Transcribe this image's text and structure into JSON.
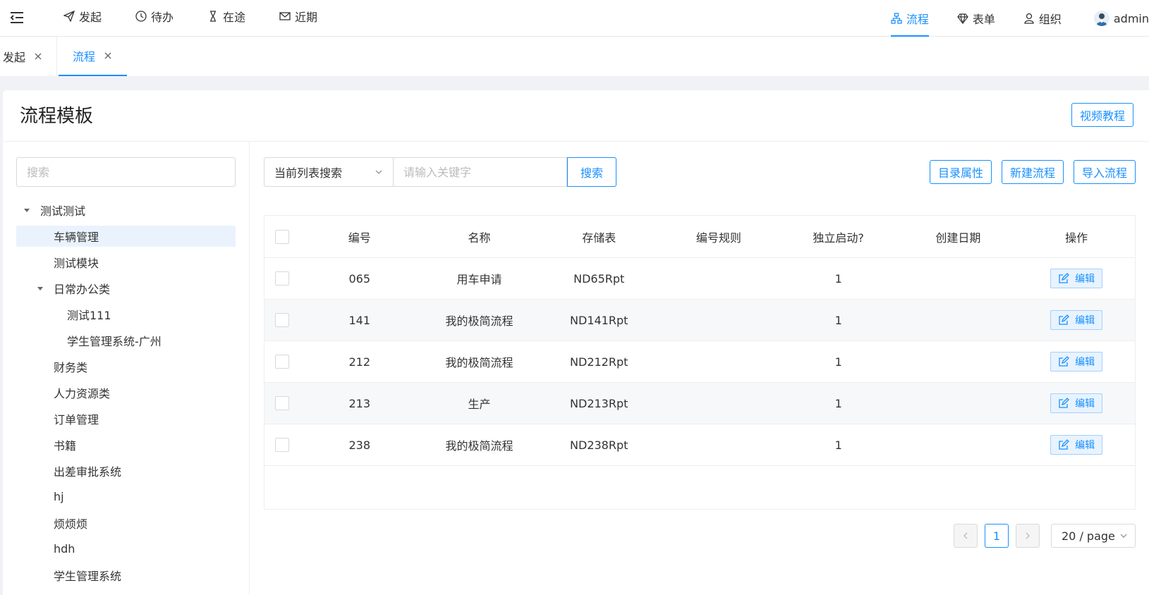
{
  "colors": {
    "accent": "#1890ff",
    "selected_bg": "#eaf3fd",
    "row_alt": "#f7f8fa"
  },
  "topnav": {
    "left": [
      {
        "label": "发起",
        "icon": "send-icon"
      },
      {
        "label": "待办",
        "icon": "clock-icon"
      },
      {
        "label": "在途",
        "icon": "hourglass-icon"
      },
      {
        "label": "近期",
        "icon": "mail-icon"
      }
    ],
    "right": [
      {
        "label": "流程",
        "icon": "flowchart-icon",
        "active": true
      },
      {
        "label": "表单",
        "icon": "diamond-icon"
      },
      {
        "label": "组织",
        "icon": "user-icon"
      }
    ],
    "user": "admin"
  },
  "tabs": [
    {
      "label": "发起"
    },
    {
      "label": "流程",
      "active": true
    }
  ],
  "page": {
    "title": "流程模板",
    "video_button": "视频教程"
  },
  "tree": {
    "search_placeholder": "搜索",
    "nodes": [
      {
        "label": "测试测试",
        "level": 0,
        "expanded": true
      },
      {
        "label": "车辆管理",
        "level": 1,
        "selected": true
      },
      {
        "label": "测试模块",
        "level": 1
      },
      {
        "label": "日常办公类",
        "level": 1,
        "expanded": true
      },
      {
        "label": "测试111",
        "level": 2
      },
      {
        "label": "学生管理系统-广州",
        "level": 2
      },
      {
        "label": "财务类",
        "level": 1
      },
      {
        "label": "人力资源类",
        "level": 1
      },
      {
        "label": "订单管理",
        "level": 1
      },
      {
        "label": "书籍",
        "level": 1
      },
      {
        "label": "出差审批系统",
        "level": 1
      },
      {
        "label": "hj",
        "level": 1
      },
      {
        "label": "烦烦烦",
        "level": 1
      },
      {
        "label": "hdh",
        "level": 1
      },
      {
        "label": "学生管理系统",
        "level": 1
      }
    ]
  },
  "toolbar": {
    "scope": "当前列表搜索",
    "keyword_placeholder": "请输入关键字",
    "search": "搜索",
    "dir_props": "目录属性",
    "new_flow": "新建流程",
    "import_flow": "导入流程"
  },
  "table": {
    "columns": [
      "编号",
      "名称",
      "存储表",
      "编号规则",
      "独立启动?",
      "创建日期",
      "操作"
    ],
    "edit_label": "编辑",
    "rows": [
      {
        "no": "065",
        "name": "用车申请",
        "table": "ND65Rpt",
        "rule": "",
        "independent": "1",
        "date": ""
      },
      {
        "no": "141",
        "name": "我的极简流程",
        "table": "ND141Rpt",
        "rule": "",
        "independent": "1",
        "date": ""
      },
      {
        "no": "212",
        "name": "我的极简流程",
        "table": "ND212Rpt",
        "rule": "",
        "independent": "1",
        "date": ""
      },
      {
        "no": "213",
        "name": "生产",
        "table": "ND213Rpt",
        "rule": "",
        "independent": "1",
        "date": ""
      },
      {
        "no": "238",
        "name": "我的极简流程",
        "table": "ND238Rpt",
        "rule": "",
        "independent": "1",
        "date": ""
      }
    ]
  },
  "pager": {
    "current": "1",
    "page_size": "20 / page"
  }
}
